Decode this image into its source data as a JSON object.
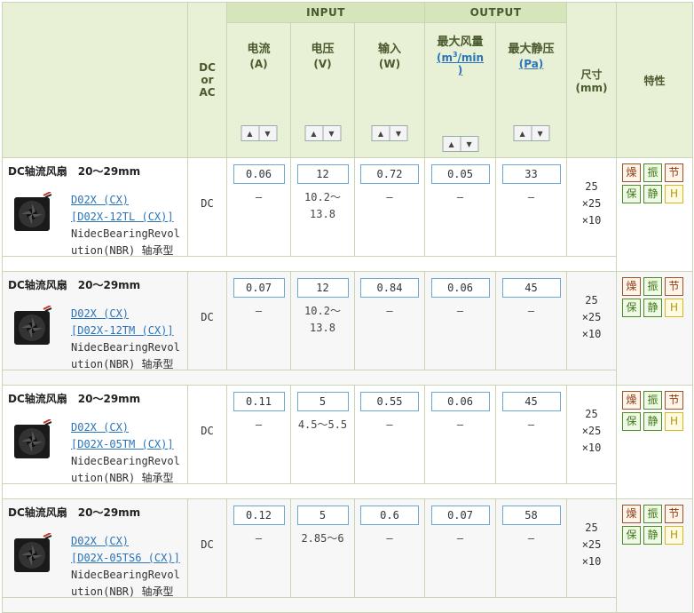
{
  "header": {
    "dc_or_ac": [
      "DC",
      "or",
      "AC"
    ],
    "input_group": "INPUT",
    "output_group": "OUTPUT",
    "columns": {
      "current": {
        "label": "电流",
        "unit": "(A)"
      },
      "voltage": {
        "label": "电压",
        "unit": "(V)"
      },
      "power": {
        "label": "输入",
        "unit": "(W)"
      },
      "airflow": {
        "label": "最大风量",
        "unit_pre": "(m",
        "unit_sup": "3",
        "unit_post": "/min",
        "unit_close": ")"
      },
      "pressure": {
        "label": "最大静压",
        "unit": "(Pa)"
      },
      "size": {
        "label": "尺寸",
        "unit": "(mm)"
      },
      "features": {
        "label": "特性"
      }
    },
    "sort_up": "▲",
    "sort_down": "▼"
  },
  "products": [
    {
      "title": "DC轴流风扇　20～29mm",
      "link1": "D02X (CX)",
      "link2": "[D02X-12TL (CX)]",
      "desc1": "NidecBearingRevol",
      "desc2": "ution(NBR) 轴承型",
      "dc": "DC",
      "current": "0.06",
      "current_sub": "–",
      "voltage": "12",
      "voltage_sub1": "10.2～",
      "voltage_sub2": "13.8",
      "power": "0.72",
      "power_sub": "–",
      "airflow": "0.05",
      "airflow_sub": "–",
      "pressure": "33",
      "pressure_sub": "–",
      "size": [
        "25",
        "×25",
        "×10"
      ],
      "features": [
        "燥",
        "振",
        "节",
        "保",
        "静",
        "H"
      ]
    },
    {
      "title": "DC轴流风扇　20～29mm",
      "link1": "D02X (CX)",
      "link2": "[D02X-12TM (CX)]",
      "desc1": "NidecBearingRevol",
      "desc2": "ution(NBR) 轴承型",
      "dc": "DC",
      "current": "0.07",
      "current_sub": "–",
      "voltage": "12",
      "voltage_sub1": "10.2～",
      "voltage_sub2": "13.8",
      "power": "0.84",
      "power_sub": "–",
      "airflow": "0.06",
      "airflow_sub": "–",
      "pressure": "45",
      "pressure_sub": "–",
      "size": [
        "25",
        "×25",
        "×10"
      ],
      "features": [
        "燥",
        "振",
        "节",
        "保",
        "静",
        "H"
      ]
    },
    {
      "title": "DC轴流风扇　20～29mm",
      "link1": "D02X (CX)",
      "link2": "[D02X-05TM (CX)]",
      "desc1": "NidecBearingRevol",
      "desc2": "ution(NBR) 轴承型",
      "dc": "DC",
      "current": "0.11",
      "current_sub": "–",
      "voltage": "5",
      "voltage_sub1": "4.5～5.5",
      "voltage_sub2": "",
      "power": "0.55",
      "power_sub": "–",
      "airflow": "0.06",
      "airflow_sub": "–",
      "pressure": "45",
      "pressure_sub": "–",
      "size": [
        "25",
        "×25",
        "×10"
      ],
      "features": [
        "燥",
        "振",
        "节",
        "保",
        "静",
        "H"
      ]
    },
    {
      "title": "DC轴流风扇　20～29mm",
      "link1": "D02X (CX)",
      "link2": "[D02X-05TS6 (CX)]",
      "desc1": "NidecBearingRevol",
      "desc2": "ution(NBR) 轴承型",
      "dc": "DC",
      "current": "0.12",
      "current_sub": "–",
      "voltage": "5",
      "voltage_sub1": "2.85～6",
      "voltage_sub2": "",
      "power": "0.6",
      "power_sub": "–",
      "airflow": "0.07",
      "airflow_sub": "–",
      "pressure": "58",
      "pressure_sub": "–",
      "size": [
        "25",
        "×25",
        "×10"
      ],
      "features": [
        "燥",
        "振",
        "节",
        "保",
        "静",
        "H"
      ]
    }
  ],
  "feature_colors": [
    "brown",
    "green",
    "brown",
    "green",
    "green",
    "yellow"
  ]
}
